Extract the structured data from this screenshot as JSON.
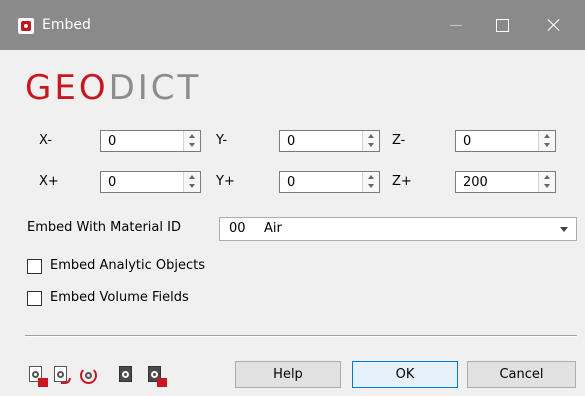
{
  "window": {
    "title": "Embed"
  },
  "brand": {
    "part1": "GEO",
    "part2": "DICT"
  },
  "coords": {
    "x_minus": {
      "label": "X-",
      "value": "0"
    },
    "y_minus": {
      "label": "Y-",
      "value": "0"
    },
    "z_minus": {
      "label": "Z-",
      "value": "0"
    },
    "x_plus": {
      "label": "X+",
      "value": "0"
    },
    "y_plus": {
      "label": "Y+",
      "value": "0"
    },
    "z_plus": {
      "label": "Z+",
      "value": "200"
    }
  },
  "material": {
    "label": "Embed With Material ID",
    "id": "00",
    "name": "Air"
  },
  "options": [
    {
      "label": "Embed Analytic Objects",
      "checked": false
    },
    {
      "label": "Embed Volume Fields",
      "checked": false
    }
  ],
  "toolbar_icons": [
    "load-settings-icon",
    "save-settings-icon",
    "reset-settings-icon",
    "edit-settings-icon",
    "save-macro-icon"
  ],
  "buttons": {
    "help": "Help",
    "ok": "OK",
    "cancel": "Cancel"
  },
  "colors": {
    "brand_red": "#c8171e",
    "brand_gray": "#8c8c8c",
    "titlebar": "#8a8a8a",
    "ok_border": "#0078d7"
  }
}
